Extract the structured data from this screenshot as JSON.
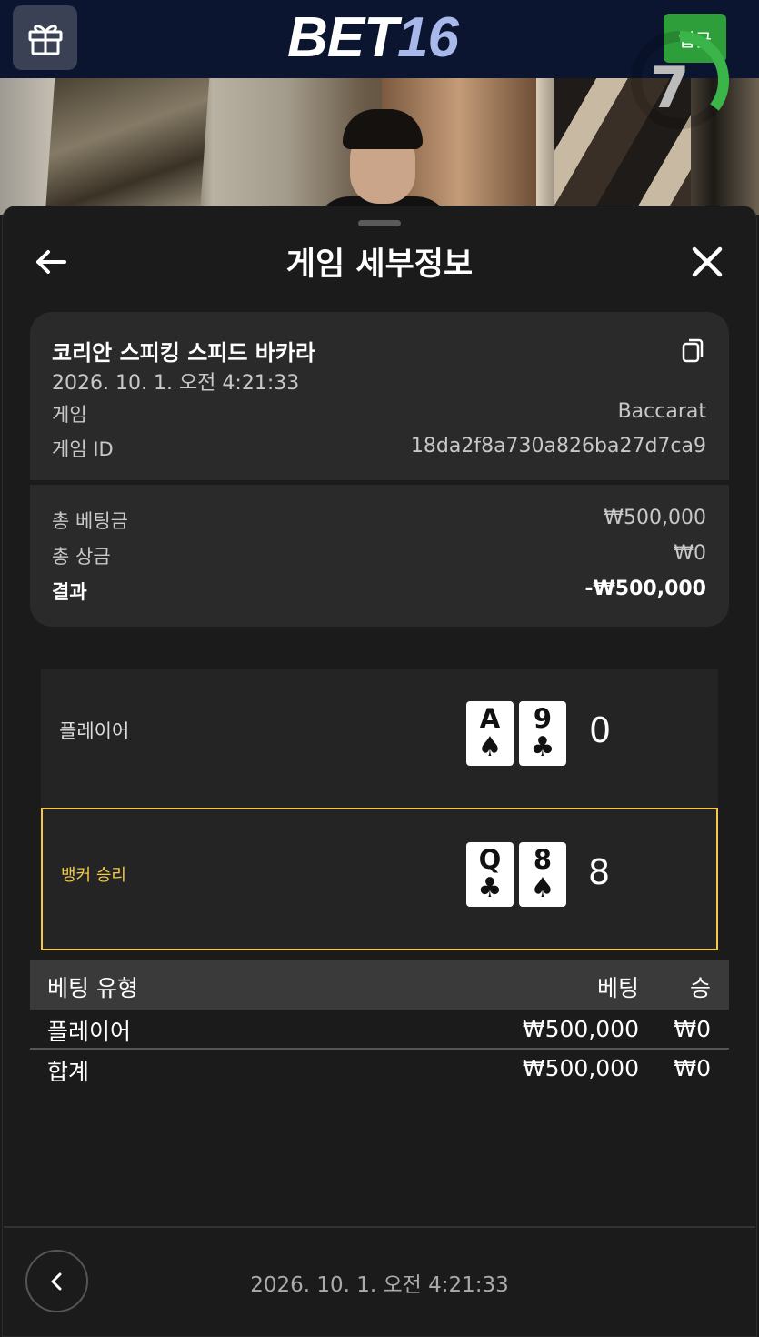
{
  "header": {
    "logo_left": "BET",
    "logo_right": "16",
    "deposit_label": "입금"
  },
  "video": {
    "countdown": "7"
  },
  "sheet": {
    "title": "게임 세부정보"
  },
  "details": {
    "game_name": "코리안 스피킹 스피드 바카라",
    "timestamp": "2026. 10. 1. 오전 4:21:33",
    "rows": [
      {
        "label": "게임",
        "value": "Baccarat"
      },
      {
        "label": "게임 ID",
        "value": "18da2f8a730a826ba27d7ca9"
      }
    ],
    "totals": [
      {
        "label": "총 베팅금",
        "value": "₩500,000"
      },
      {
        "label": "총 상금",
        "value": "₩0"
      },
      {
        "label": "결과",
        "value": "-₩500,000"
      }
    ]
  },
  "result": {
    "player": {
      "label": "플레이어",
      "cards": [
        {
          "rank": "A",
          "suit": "♠"
        },
        {
          "rank": "9",
          "suit": "♣"
        }
      ],
      "score": "0"
    },
    "banker": {
      "label": "뱅커 승리",
      "cards": [
        {
          "rank": "Q",
          "suit": "♣"
        },
        {
          "rank": "8",
          "suit": "♠"
        }
      ],
      "score": "8"
    }
  },
  "bet_table": {
    "headers": [
      "베팅 유형",
      "베팅",
      "승"
    ],
    "rows": [
      [
        "플레이어",
        "₩500,000",
        "₩0"
      ],
      [
        "합계",
        "₩500,000",
        "₩0"
      ]
    ]
  },
  "footer": {
    "timestamp": "2026. 10. 1. 오전 4:21:33"
  },
  "colors": {
    "topbar": "#0b1530",
    "deposit": "#2e9e3a",
    "logo_accent": "#a9b8ea",
    "timer_ring": "#3bb54a",
    "banker_highlight": "#f2c94c"
  }
}
